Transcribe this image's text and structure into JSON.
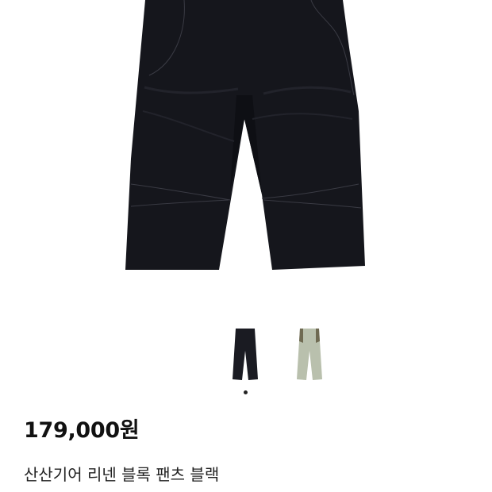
{
  "product": {
    "price": "179,000원",
    "title": "산산기어 리넨 블록 팬츠 블랙"
  },
  "gallery": {
    "active_index": 0,
    "thumbnails": [
      {
        "color_name": "black",
        "color": "#1a1b22"
      },
      {
        "color_name": "khaki",
        "color": "#b9c0ad",
        "accent": "#6f6a52"
      }
    ]
  },
  "colors": {
    "pants_main": "#15161c",
    "pants_shadow": "#0e0f14",
    "stitch": "#3a3b44",
    "dot_active": "#222222",
    "background": "#ffffff"
  }
}
